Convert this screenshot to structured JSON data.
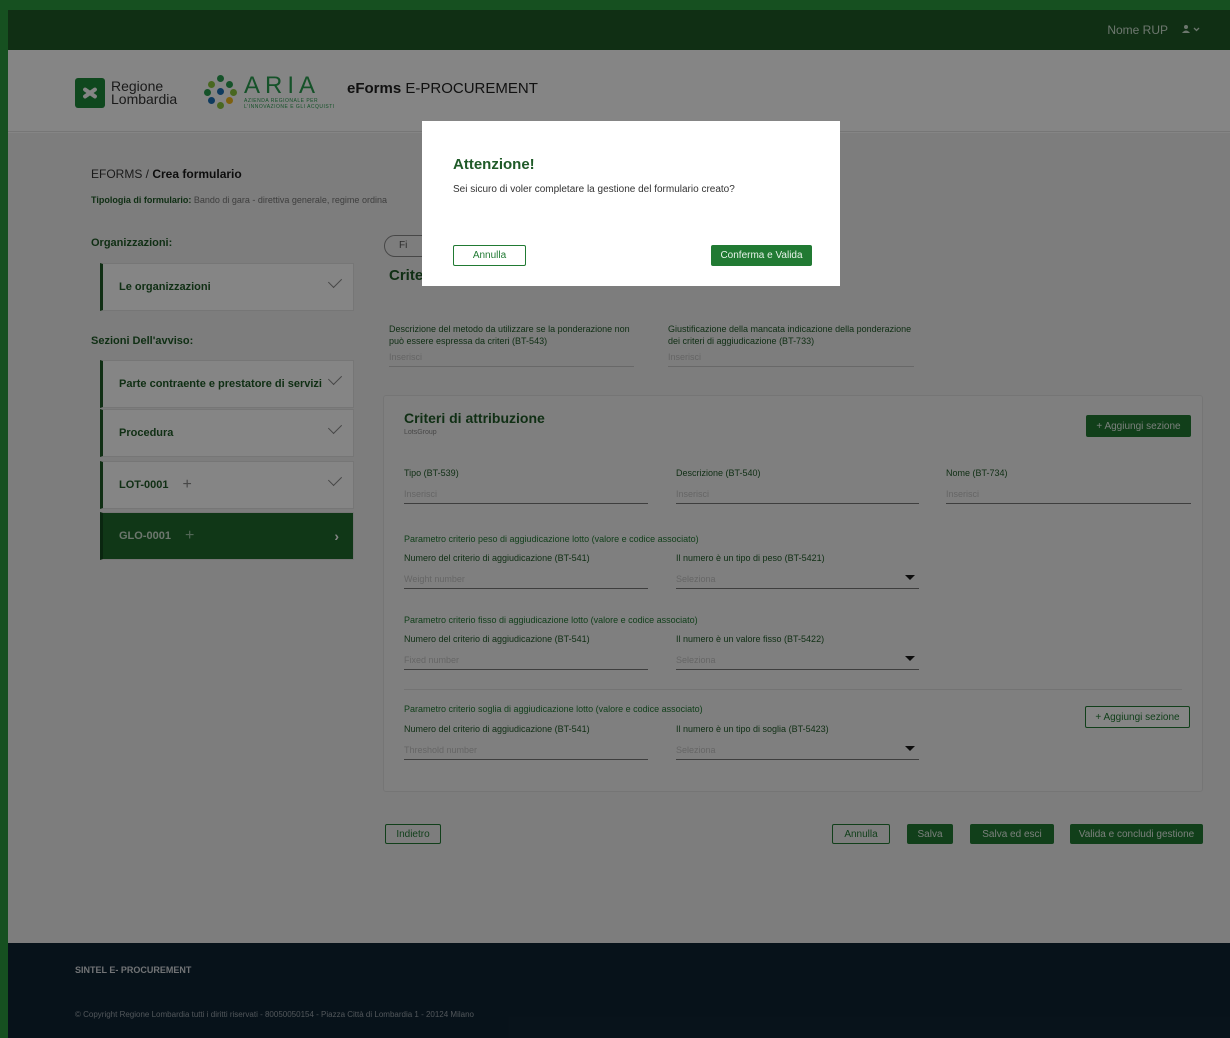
{
  "topbar": {
    "user_name": "Nome RUP",
    "user_icon": "user-icon",
    "chevron_icon": "chevron-down-icon"
  },
  "header": {
    "rl_line1": "Regione",
    "rl_line2": "Lombardia",
    "aria_big": "ARIA",
    "aria_small1": "AZIENDA REGIONALE PER",
    "aria_small2": "L'INNOVAZIONE E GLI ACQUISTI",
    "app_title_bold": "eForms",
    "app_title_rest": " E-PROCUREMENT"
  },
  "breadcrumb": {
    "root": "EFORMS / ",
    "current": "Crea formulario"
  },
  "tipologia": {
    "label": "Tipologia di formulario:",
    "value": " Bando di gara - direttiva generale, regime ordina"
  },
  "sidebar": {
    "org_label": "Organizzazioni:",
    "org_item": "Le organizzazioni",
    "sections_label": "Sezioni Dell'avviso:",
    "items": [
      {
        "label": "Parte contraente e prestatore di servizi"
      },
      {
        "label": "Procedura"
      },
      {
        "label": "LOT-0001"
      },
      {
        "label": "GLO-0001"
      }
    ]
  },
  "main": {
    "pill_label": "Fi",
    "section_title": "Crite",
    "desc_left_label": "Descrizione del metodo da utilizzare se la ponderazione non può essere espressa da criteri (BT-543)",
    "desc_left_placeholder": "Inserisci",
    "desc_right_label": "Giustificazione della mancata indicazione della ponderazione dei criteri di aggiudicazione (BT-733)",
    "desc_right_placeholder": "Inserisci"
  },
  "card": {
    "title": "Criteri di attribuzione",
    "subtitle": "LotsGroup",
    "add_section_top": "+ Aggiungi sezione",
    "tipo_label": "Tipo (BT-539)",
    "tipo_ph": "Inserisci",
    "descr_label": "Descrizione (BT-540)",
    "descr_ph": "Inserisci",
    "nome_label": "Nome (BT-734)",
    "nome_ph": "Inserisci",
    "g1_title": "Parametro criterio peso di aggiudicazione lotto (valore e codice associato)",
    "g1_num_label": "Numero del criterio di aggiudicazione (BT-541)",
    "g1_num_ph": "Weight number",
    "g1_sel_label": "Il numero è un tipo di peso (BT-5421)",
    "g1_sel_ph": "Seleziona",
    "g2_title": "Parametro criterio fisso di aggiudicazione lotto (valore e codice associato)",
    "g2_num_label": "Numero del criterio di aggiudicazione (BT-541)",
    "g2_num_ph": "Fixed number",
    "g2_sel_label": "Il numero è un valore fisso (BT-5422)",
    "g2_sel_ph": "Seleziona",
    "g3_title": "Parametro criterio soglia di aggiudicazione lotto (valore e codice associato)",
    "g3_num_label": "Numero del criterio di aggiudicazione (BT-541)",
    "g3_num_ph": "Threshold number",
    "g3_sel_label": "Il numero è un tipo di soglia (BT-5423)",
    "g3_sel_ph": "Seleziona",
    "add_section_bottom": "+ Aggiungi sezione"
  },
  "actions": {
    "back": "Indietro",
    "cancel": "Annulla",
    "save": "Salva",
    "save_exit": "Salva ed esci",
    "validate": "Valida e concludi gestione"
  },
  "footer": {
    "title": "SINTEL E- PROCUREMENT",
    "copyright": "© Copyright Regione Lombardia tutti i diritti riservati - 80050050154 - Piazza Città di Lombardia 1 - 20124 Milano"
  },
  "modal": {
    "title": "Attenzione!",
    "text": "Sei sicuro di voler completare la gestione del formulario creato?",
    "cancel": "Annulla",
    "confirm": "Conferma e Valida"
  },
  "colors": {
    "brand_green": "#1f5a28",
    "button_green": "#217a33",
    "footer_navy": "#0f2433",
    "frame_border": "#2b9a3e"
  }
}
